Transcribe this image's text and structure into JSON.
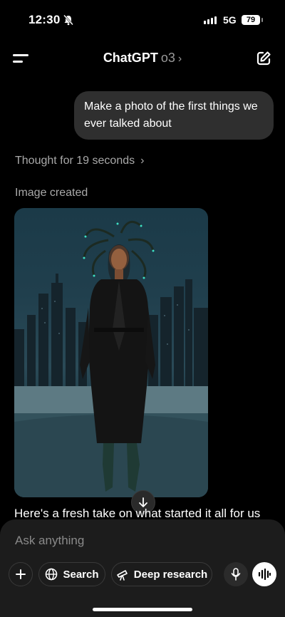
{
  "status": {
    "time": "12:30",
    "network": "5G",
    "battery": "79"
  },
  "header": {
    "title": "ChatGPT",
    "model": "o3",
    "chevron": "›"
  },
  "conversation": {
    "user_message": "Make a photo of the first things we ever talked about",
    "thought": "Thought for 19 seconds",
    "thought_chevron": "›",
    "image_status": "Image created",
    "assistant_reply": "Here's a fresh take on what started it all for us"
  },
  "composer": {
    "placeholder": "Ask anything",
    "search_label": "Search",
    "deep_research_label": "Deep research"
  },
  "icons": [
    "bell-slash-icon",
    "menu-icon",
    "new-chat-icon",
    "arrow-down-icon",
    "plus-icon",
    "globe-icon",
    "telescope-icon",
    "mic-icon",
    "voice-waveform-icon"
  ]
}
